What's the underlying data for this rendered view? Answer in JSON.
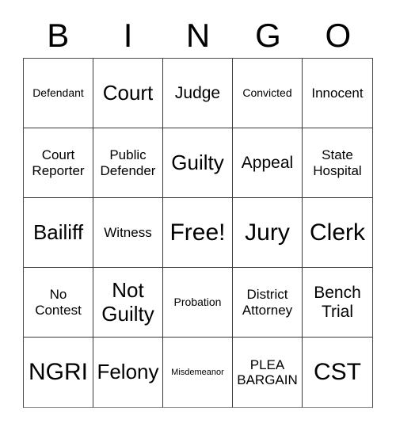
{
  "card": {
    "title": "BINGO",
    "header": {
      "letters": [
        "B",
        "I",
        "N",
        "G",
        "O"
      ]
    },
    "grid": {
      "rows": 5,
      "columns": 5,
      "border_color": "#3a3a3a",
      "background_color": "#ffffff",
      "text_color": "#000000",
      "free_space_index": 12,
      "cells": [
        {
          "text": "Defendant",
          "size": "s"
        },
        {
          "text": "Court",
          "size": "xl"
        },
        {
          "text": "Judge",
          "size": "l"
        },
        {
          "text": "Convicted",
          "size": "s"
        },
        {
          "text": "Innocent",
          "size": "m"
        },
        {
          "text": "Court\nReporter",
          "size": "m"
        },
        {
          "text": "Public\nDefender",
          "size": "m"
        },
        {
          "text": "Guilty",
          "size": "xl"
        },
        {
          "text": "Appeal",
          "size": "l"
        },
        {
          "text": "State\nHospital",
          "size": "m"
        },
        {
          "text": "Bailiff",
          "size": "xl"
        },
        {
          "text": "Witness",
          "size": "m"
        },
        {
          "text": "Free!",
          "size": "xxl"
        },
        {
          "text": "Jury",
          "size": "xxl"
        },
        {
          "text": "Clerk",
          "size": "xxl"
        },
        {
          "text": "No\nContest",
          "size": "m"
        },
        {
          "text": "Not\nGuilty",
          "size": "xl"
        },
        {
          "text": "Probation",
          "size": "s"
        },
        {
          "text": "District\nAttorney",
          "size": "m"
        },
        {
          "text": "Bench\nTrial",
          "size": "l"
        },
        {
          "text": "NGRI",
          "size": "xxl"
        },
        {
          "text": "Felony",
          "size": "xl"
        },
        {
          "text": "Misdemeanor",
          "size": "xs"
        },
        {
          "text": "PLEA\nBARGAIN",
          "size": "m"
        },
        {
          "text": "CST",
          "size": "xxl"
        }
      ]
    }
  }
}
